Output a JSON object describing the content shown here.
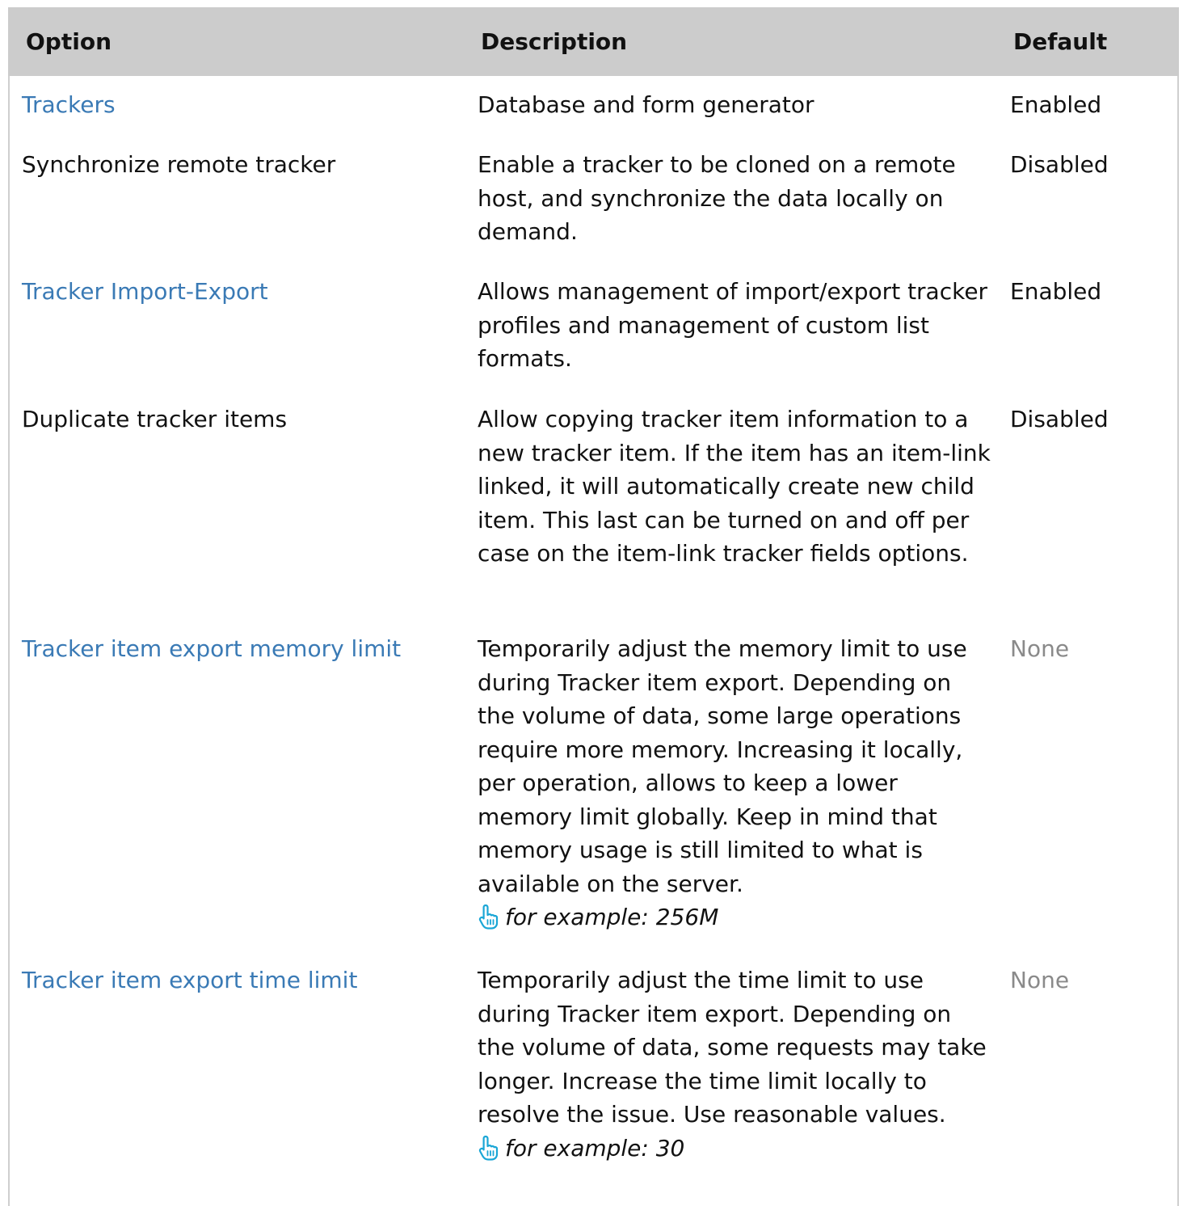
{
  "table": {
    "headers": {
      "option": "Option",
      "description": "Description",
      "default": "Default"
    },
    "rows": [
      {
        "option": "Trackers",
        "option_is_link": true,
        "description": "Database and form generator",
        "default": "Enabled"
      },
      {
        "option": "Synchronize remote tracker",
        "option_is_link": false,
        "description": "Enable a tracker to be cloned on a remote host, and synchronize the data locally on demand.",
        "default": "Disabled"
      },
      {
        "option": "Tracker Import-Export",
        "option_is_link": true,
        "description": "Allows management of import/export tracker profiles and management of custom list formats.",
        "default": "Enabled"
      },
      {
        "option": "Duplicate tracker items",
        "option_is_link": false,
        "description": "Allow copying tracker item information to a new tracker item. If the item has an item-link linked, it will automatically create new child item. This last can be turned on and off per case on the item-link tracker fields options.",
        "default": "Disabled"
      },
      {
        "option": "Tracker item export memory limit",
        "option_is_link": true,
        "description": "Temporarily adjust the memory limit to use during Tracker item export. Depending on the volume of data, some large operations require more memory. Increasing it locally, per operation, allows to keep a lower memory limit globally. Keep in mind that memory usage is still limited to what is available on the server.",
        "example": "for example: 256M",
        "default": "None"
      },
      {
        "option": "Tracker item export time limit",
        "option_is_link": true,
        "description": "Temporarily adjust the time limit to use during Tracker item export. Depending on the volume of data, some requests may take longer. Increase the time limit locally to resolve the issue. Use reasonable values.",
        "example": "for example: 30",
        "default": "None"
      }
    ]
  },
  "colors": {
    "header_bg": "#cccccc",
    "link": "#3a7ab5",
    "muted": "#8a8a8a",
    "hint_icon": "#1aa6d6"
  },
  "icons": {
    "example_hint": "pointing-hand-icon"
  }
}
